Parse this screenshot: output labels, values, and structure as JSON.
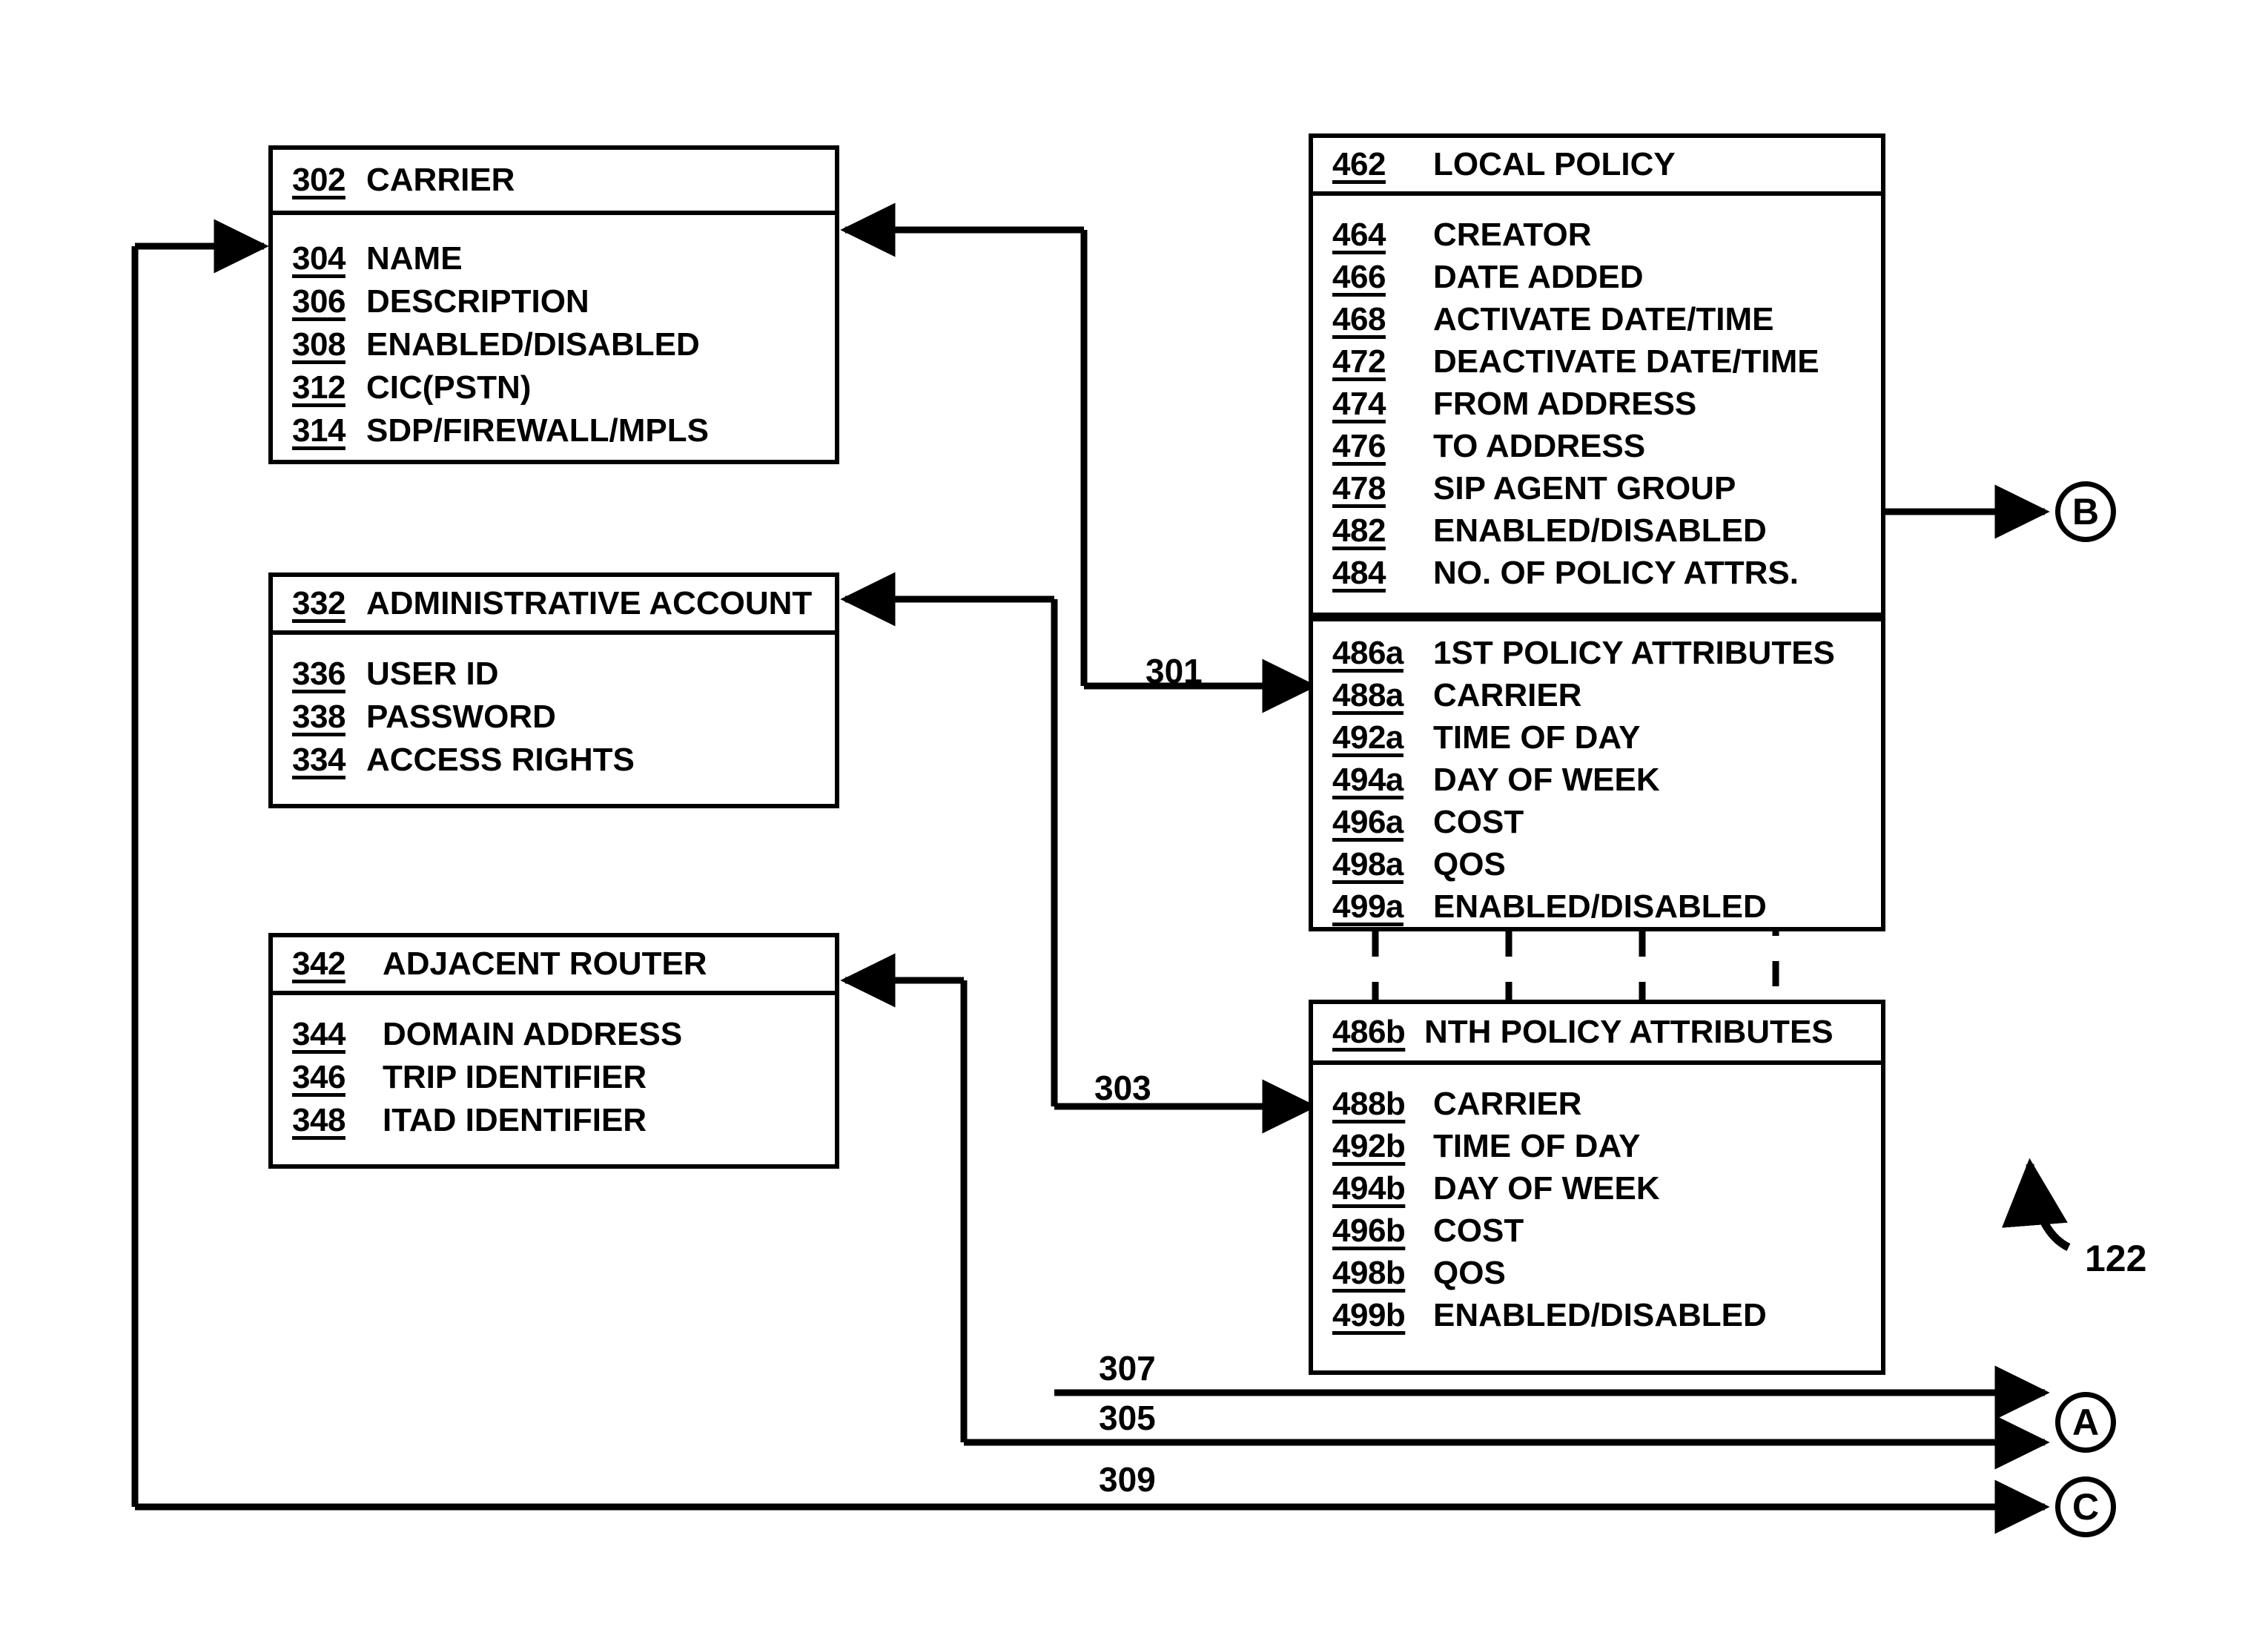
{
  "figure": {
    "reference_numeral": "122"
  },
  "entities": {
    "carrier": {
      "ref": "302",
      "title": "CARRIER",
      "fields": [
        {
          "ref": "304",
          "label": "NAME"
        },
        {
          "ref": "306",
          "label": "DESCRIPTION"
        },
        {
          "ref": "308",
          "label": "ENABLED/DISABLED"
        },
        {
          "ref": "312",
          "label": "CIC(PSTN)"
        },
        {
          "ref": "314",
          "label": "SDP/FIREWALL/MPLS"
        }
      ]
    },
    "administrative_account": {
      "ref": "332",
      "title": "ADMINISTRATIVE ACCOUNT",
      "fields": [
        {
          "ref": "336",
          "label": "USER ID"
        },
        {
          "ref": "338",
          "label": "PASSWORD"
        },
        {
          "ref": "334",
          "label": "ACCESS RIGHTS"
        }
      ]
    },
    "adjacent_router": {
      "ref": "342",
      "title": "ADJACENT ROUTER",
      "fields": [
        {
          "ref": "344",
          "label": "DOMAIN ADDRESS"
        },
        {
          "ref": "346",
          "label": "TRIP IDENTIFIER"
        },
        {
          "ref": "348",
          "label": "ITAD IDENTIFIER"
        }
      ]
    },
    "local_policy": {
      "ref": "462",
      "title": "LOCAL POLICY",
      "fields": [
        {
          "ref": "464",
          "label": "CREATOR"
        },
        {
          "ref": "466",
          "label": "DATE ADDED"
        },
        {
          "ref": "468",
          "label": "ACTIVATE DATE/TIME"
        },
        {
          "ref": "472",
          "label": "DEACTIVATE DATE/TIME"
        },
        {
          "ref": "474",
          "label": "FROM ADDRESS"
        },
        {
          "ref": "476",
          "label": "TO ADDRESS"
        },
        {
          "ref": "478",
          "label": "SIP AGENT GROUP"
        },
        {
          "ref": "482",
          "label": "ENABLED/DISABLED"
        },
        {
          "ref": "484",
          "label": "NO. OF POLICY ATTRS."
        }
      ]
    },
    "first_policy_attributes": {
      "ref": "486a",
      "title": "1ST POLICY ATTRIBUTES",
      "fields": [
        {
          "ref": "488a",
          "label": "CARRIER"
        },
        {
          "ref": "492a",
          "label": "TIME OF DAY"
        },
        {
          "ref": "494a",
          "label": "DAY OF WEEK"
        },
        {
          "ref": "496a",
          "label": "COST"
        },
        {
          "ref": "498a",
          "label": "QOS"
        },
        {
          "ref": "499a",
          "label": "ENABLED/DISABLED"
        }
      ]
    },
    "nth_policy_attributes": {
      "ref": "486b",
      "title": "NTH POLICY ATTRIBUTES",
      "fields": [
        {
          "ref": "488b",
          "label": "CARRIER"
        },
        {
          "ref": "492b",
          "label": "TIME OF DAY"
        },
        {
          "ref": "494b",
          "label": "DAY OF WEEK"
        },
        {
          "ref": "496b",
          "label": "COST"
        },
        {
          "ref": "498b",
          "label": "QOS"
        },
        {
          "ref": "499b",
          "label": "ENABLED/DISABLED"
        }
      ]
    }
  },
  "connectors": [
    {
      "id": "c301",
      "label": "301"
    },
    {
      "id": "c303",
      "label": "303"
    },
    {
      "id": "c305",
      "label": "305"
    },
    {
      "id": "c307",
      "label": "307"
    },
    {
      "id": "c309",
      "label": "309"
    }
  ],
  "offpage_connectors": [
    {
      "id": "A",
      "label": "A"
    },
    {
      "id": "B",
      "label": "B"
    },
    {
      "id": "C",
      "label": "C"
    }
  ],
  "colors": {
    "ink": "#000000",
    "paper": "#ffffff"
  }
}
